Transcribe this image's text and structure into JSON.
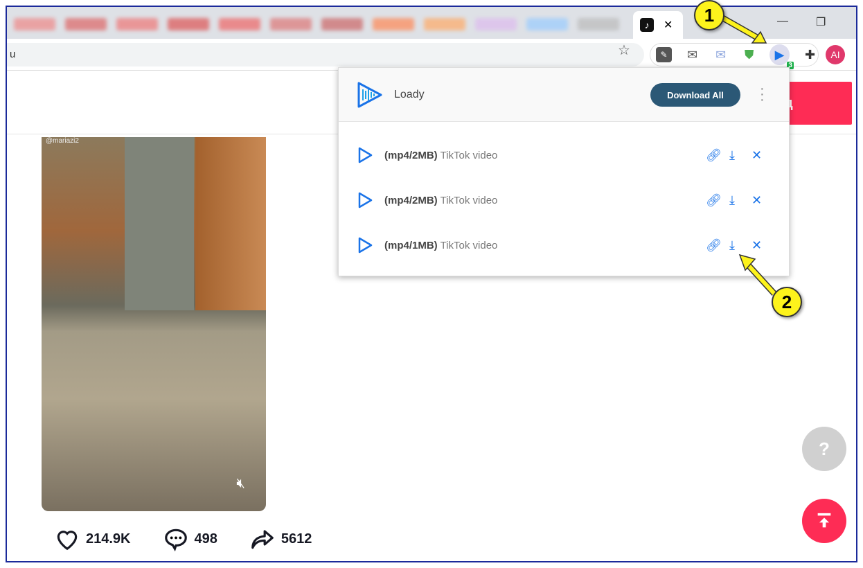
{
  "browser": {
    "active_tab_close": "✕",
    "address_partial": "u",
    "extensions": [
      "cursor-extension-icon",
      "mail-icon",
      "mail-light-icon",
      "adguard-shield-icon",
      "loady-icon",
      "puzzle-extensions-icon"
    ],
    "loady_badge": "3",
    "profile_initials": "AI"
  },
  "page": {
    "header_button_partial": "д",
    "video_username": "@mariazi2",
    "stats": {
      "likes": "214.9K",
      "comments": "498",
      "shares": "5612"
    }
  },
  "popup": {
    "brand": "Loady",
    "download_all": "Download All",
    "items": [
      {
        "format": "(mp4/2MB)",
        "title": "TikTok video"
      },
      {
        "format": "(mp4/2MB)",
        "title": "TikTok video"
      },
      {
        "format": "(mp4/1MB)",
        "title": "TikTok video"
      }
    ]
  },
  "annotations": [
    "1",
    "2"
  ],
  "colors": {
    "accent": "#1a73e8",
    "download_all": "#2b5876",
    "tiktok_red": "#fe2c55",
    "callout": "#fdf31c"
  }
}
